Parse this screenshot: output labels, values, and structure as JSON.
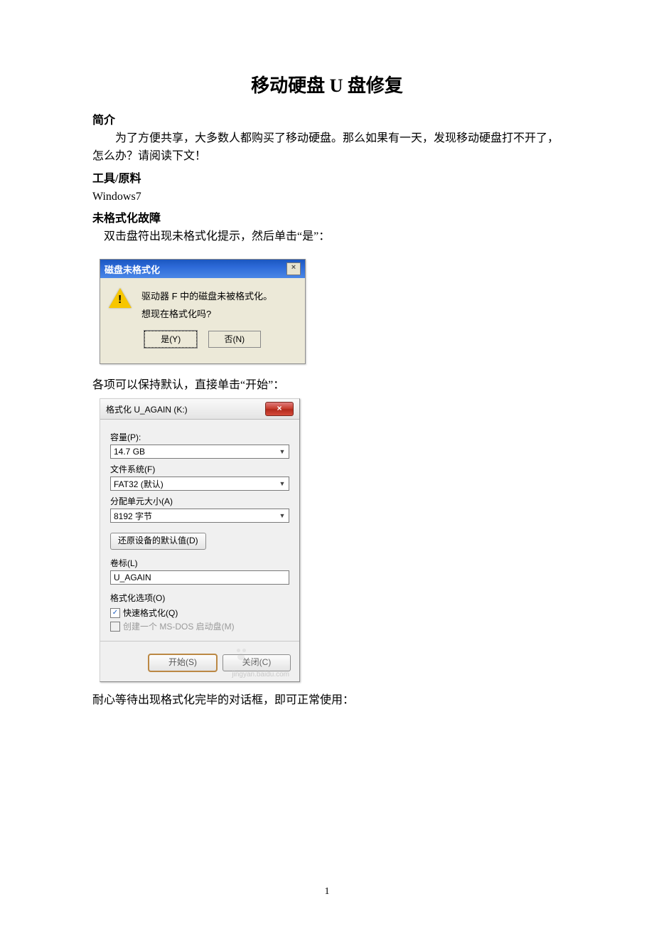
{
  "title": "移动硬盘 U 盘修复",
  "sections": {
    "intro_heading": "简介",
    "intro_body": "为了方便共享，大多数人都购买了移动硬盘。那么如果有一天，发现移动硬盘打不开了，怎么办？请阅读下文！",
    "tools_heading": "工具/原料",
    "tools_body": "Windows7",
    "fault_heading": "未格式化故障",
    "fault_step1": "双击盘符出现未格式化提示，然后单击“是”：",
    "fault_step2": "各项可以保持默认，直接单击“开始”：",
    "fault_step3": "耐心等待出现格式化完毕的对话框，即可正常使用："
  },
  "dialog1": {
    "title": "磁盘未格式化",
    "line1": "驱动器 F 中的磁盘未被格式化。",
    "line2": "想现在格式化吗?",
    "yes": "是(Y)",
    "no": "否(N)",
    "close_glyph": "×"
  },
  "dialog2": {
    "title": "格式化 U_AGAIN (K:)",
    "close_glyph": "×",
    "capacity_label": "容量(P):",
    "capacity_value": "14.7 GB",
    "filesystem_label": "文件系统(F)",
    "filesystem_value": "FAT32 (默认)",
    "allocation_label": "分配单元大小(A)",
    "allocation_value": "8192 字节",
    "restore_defaults": "还原设备的默认值(D)",
    "volume_label": "卷标(L)",
    "volume_value": "U_AGAIN",
    "format_options": "格式化选项(O)",
    "quick_format": "快速格式化(Q)",
    "msdos_boot": "创建一个 MS-DOS 启动盘(M)",
    "start": "开始(S)",
    "close": "关闭(C)",
    "watermark": "jingyan.baidu.com"
  },
  "page_number": "1"
}
